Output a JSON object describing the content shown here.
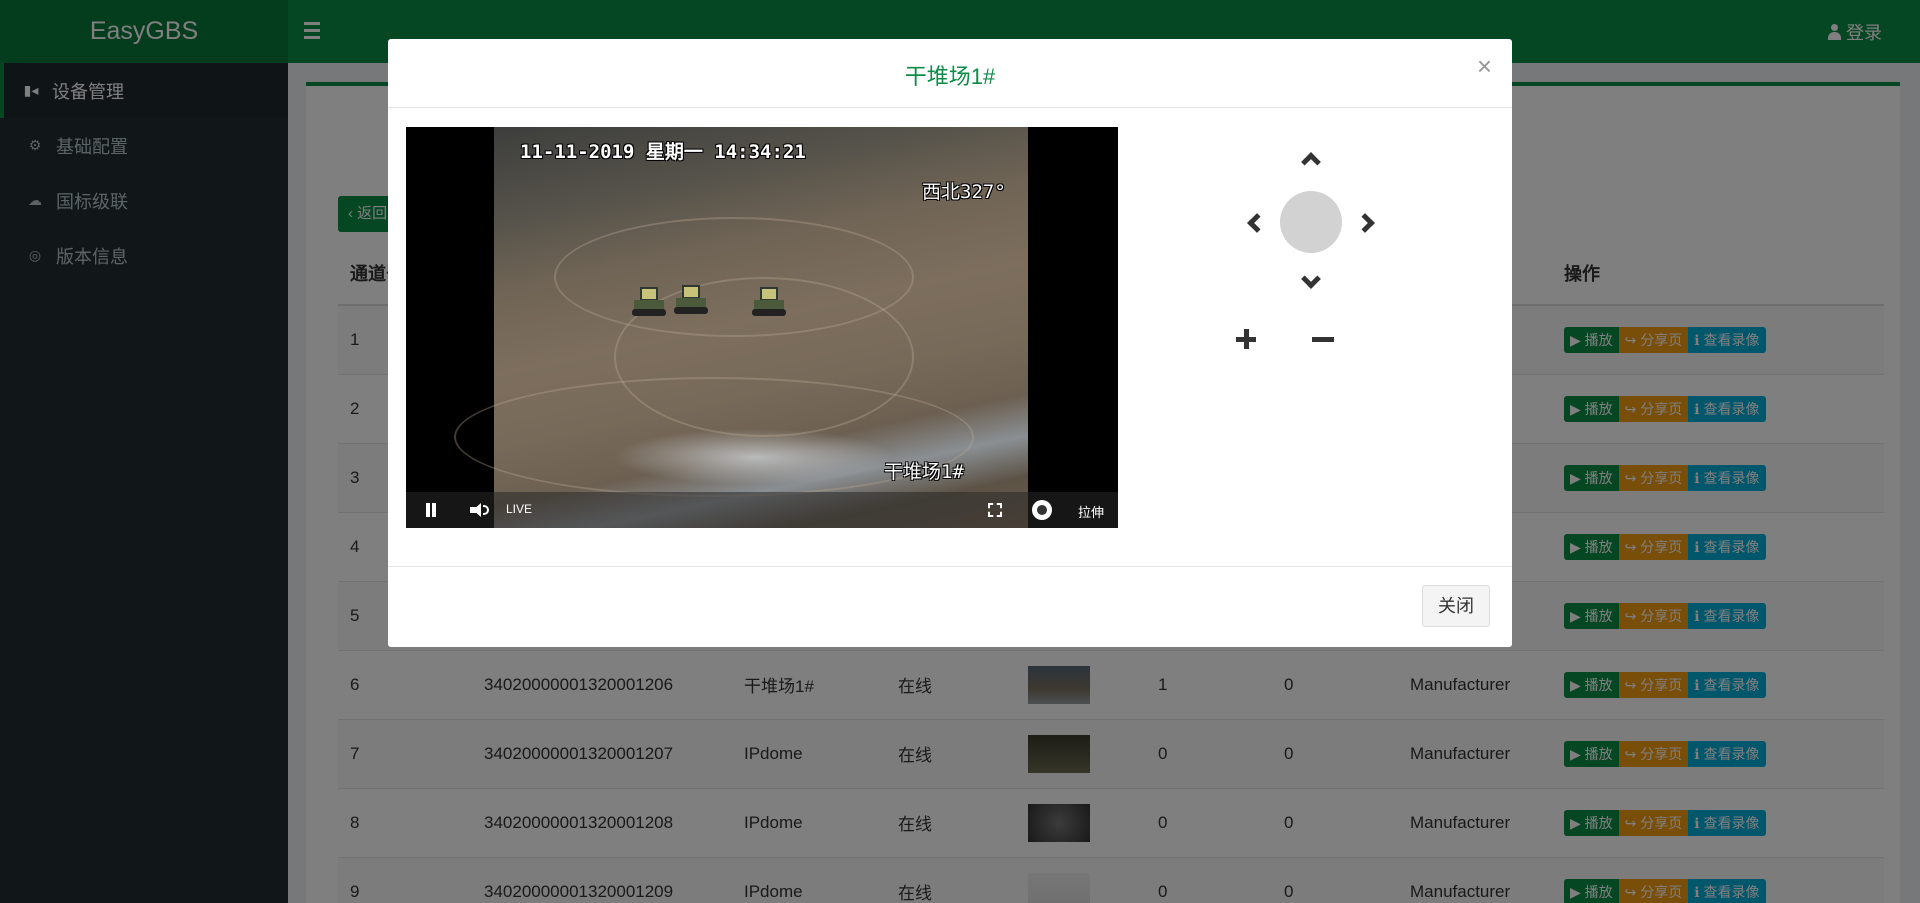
{
  "app": {
    "brand": "EasyGBS",
    "login_label": "登录"
  },
  "sidebar": {
    "items": [
      {
        "label": "设备管理",
        "icon": "video-camera-icon",
        "active": true
      },
      {
        "label": "基础配置",
        "icon": "gears-icon",
        "active": false
      },
      {
        "label": "国标级联",
        "icon": "cloud-upload-icon",
        "active": false
      },
      {
        "label": "版本信息",
        "icon": "support-icon",
        "active": false
      }
    ]
  },
  "page": {
    "back_label": "返回"
  },
  "table": {
    "headers": {
      "channel": "通道号",
      "ops": "操作"
    },
    "ops_labels": {
      "play": "播放",
      "share": "分享页",
      "record": "查看录像"
    },
    "rows": [
      {
        "channel": "1"
      },
      {
        "channel": "2"
      },
      {
        "channel": "3"
      },
      {
        "channel": "4"
      },
      {
        "channel": "5"
      },
      {
        "channel": "6",
        "id": "34020000001320001206",
        "name": "干堆场1#",
        "status": "在线",
        "c1": "1",
        "c2": "0",
        "vendor": "Manufacturer"
      },
      {
        "channel": "7",
        "id": "34020000001320001207",
        "name": "IPdome",
        "status": "在线",
        "c1": "0",
        "c2": "0",
        "vendor": "Manufacturer"
      },
      {
        "channel": "8",
        "id": "34020000001320001208",
        "name": "IPdome",
        "status": "在线",
        "c1": "0",
        "c2": "0",
        "vendor": "Manufacturer"
      },
      {
        "channel": "9",
        "id": "34020000001320001209",
        "name": "IPdome",
        "status": "在线",
        "c1": "0",
        "c2": "0",
        "vendor": "Manufacturer"
      }
    ]
  },
  "modal": {
    "title": "干堆场1#",
    "close_x": "×",
    "close_button": "关闭",
    "video": {
      "osd_time": "11-11-2019 星期一 14:34:21",
      "osd_direction": "西北327°",
      "osd_name": "干堆场1#",
      "live_label": "LIVE",
      "stretch_label": "拉伸"
    }
  },
  "colors": {
    "brand_green": "#0b8c47",
    "share_orange": "#f39c12",
    "record_blue": "#00acd6"
  }
}
